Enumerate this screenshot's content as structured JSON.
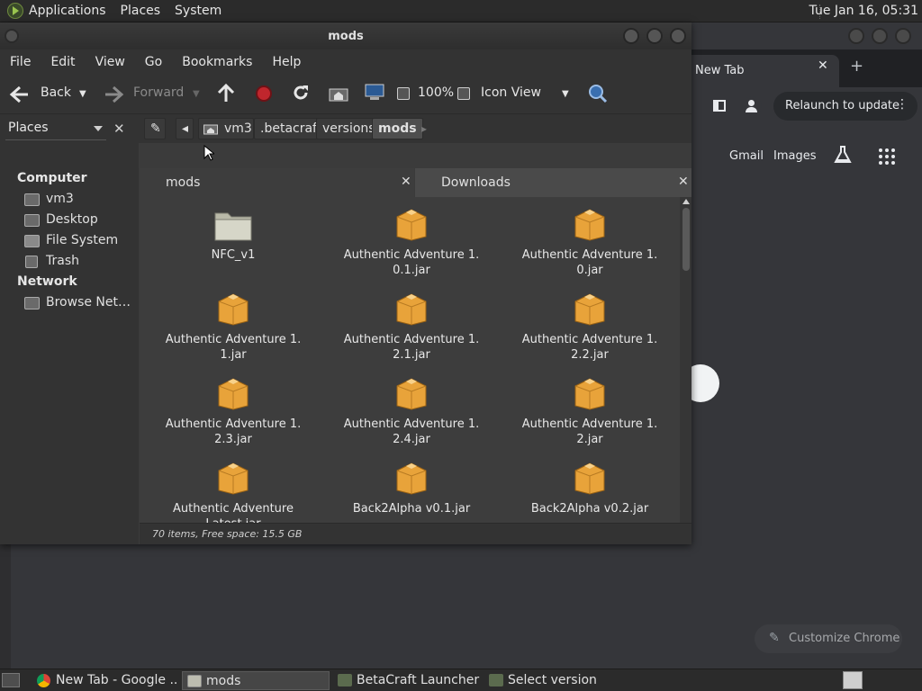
{
  "top_panel": {
    "menus": [
      "Applications",
      "Places",
      "System"
    ],
    "clock": "Tue Jan 16, 05:31"
  },
  "chrome": {
    "tab_title": "New Tab",
    "relaunch_label": "Relaunch to update",
    "links": [
      "Gmail",
      "Images"
    ],
    "customize_label": "Customize Chrome"
  },
  "file_manager": {
    "window_title": "mods",
    "menus": [
      "File",
      "Edit",
      "View",
      "Go",
      "Bookmarks",
      "Help"
    ],
    "toolbar": {
      "back": "Back",
      "forward": "Forward",
      "zoom": "100%",
      "view_mode": "Icon View"
    },
    "places_select": "Places",
    "breadcrumbs": [
      "vm3",
      ".betacraft",
      "versions",
      "mods"
    ],
    "sidebar": {
      "computer_heading": "Computer",
      "computer_items": [
        "vm3",
        "Desktop",
        "File System",
        "Trash"
      ],
      "network_heading": "Network",
      "network_items": [
        "Browse Net…"
      ]
    },
    "tabs": [
      "mods",
      "Downloads"
    ],
    "items": [
      {
        "name": "NFC_v1",
        "type": "folder"
      },
      {
        "name": "Authentic Adventure 1.\n0.1.jar",
        "type": "jar"
      },
      {
        "name": "Authentic Adventure 1.\n0.jar",
        "type": "jar"
      },
      {
        "name": "Authentic Adventure 1.\n1.jar",
        "type": "jar"
      },
      {
        "name": "Authentic Adventure 1.\n2.1.jar",
        "type": "jar"
      },
      {
        "name": "Authentic Adventure 1.\n2.2.jar",
        "type": "jar"
      },
      {
        "name": "Authentic Adventure 1.\n2.3.jar",
        "type": "jar"
      },
      {
        "name": "Authentic Adventure 1.\n2.4.jar",
        "type": "jar"
      },
      {
        "name": "Authentic Adventure 1.\n2.jar",
        "type": "jar"
      },
      {
        "name": "Authentic Adventure\nLatest.jar",
        "type": "jar"
      },
      {
        "name": "Back2Alpha v0.1.jar",
        "type": "jar"
      },
      {
        "name": "Back2Alpha v0.2.jar",
        "type": "jar"
      }
    ],
    "status": "70 items, Free space: 15.5 GB"
  },
  "taskbar": {
    "tasks": [
      "New Tab - Google ...",
      "mods",
      "BetaCraft Launcher ...",
      "Select version"
    ]
  }
}
